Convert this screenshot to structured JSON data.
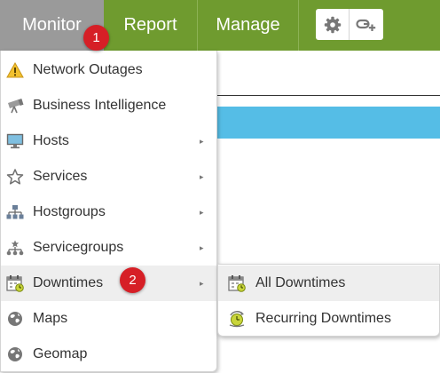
{
  "nav": {
    "items": [
      {
        "label": "Monitor"
      },
      {
        "label": "Report"
      },
      {
        "label": "Manage"
      }
    ],
    "tools": [
      {
        "icon": "gear-icon"
      },
      {
        "icon": "link-add-icon"
      }
    ]
  },
  "menu": {
    "items": [
      {
        "label": "Network Outages",
        "icon": "warning-icon",
        "submenu": false
      },
      {
        "label": "Business Intelligence",
        "icon": "bi-telescope-icon",
        "submenu": false
      },
      {
        "label": "Hosts",
        "icon": "monitor-icon",
        "submenu": true
      },
      {
        "label": "Services",
        "icon": "star-icon",
        "submenu": true
      },
      {
        "label": "Hostgroups",
        "icon": "hostgroups-icon",
        "submenu": true
      },
      {
        "label": "Servicegroups",
        "icon": "servicegroups-icon",
        "submenu": true
      },
      {
        "label": "Downtimes",
        "icon": "calendar-icon",
        "submenu": true,
        "active": true
      },
      {
        "label": "Maps",
        "icon": "globe-icon",
        "submenu": false
      },
      {
        "label": "Geomap",
        "icon": "globe-icon",
        "submenu": false
      }
    ],
    "submenu_arrow": "▸"
  },
  "submenu": {
    "items": [
      {
        "label": "All Downtimes",
        "icon": "calendar-icon",
        "active": true
      },
      {
        "label": "Recurring Downtimes",
        "icon": "recurring-clock-icon"
      }
    ]
  },
  "callouts": [
    "1",
    "2"
  ],
  "colors": {
    "nav_green": "#6f9b2f",
    "nav_active_gray": "#9a9a9a",
    "band_blue": "#55bde6",
    "callout_red": "#d61f26"
  }
}
